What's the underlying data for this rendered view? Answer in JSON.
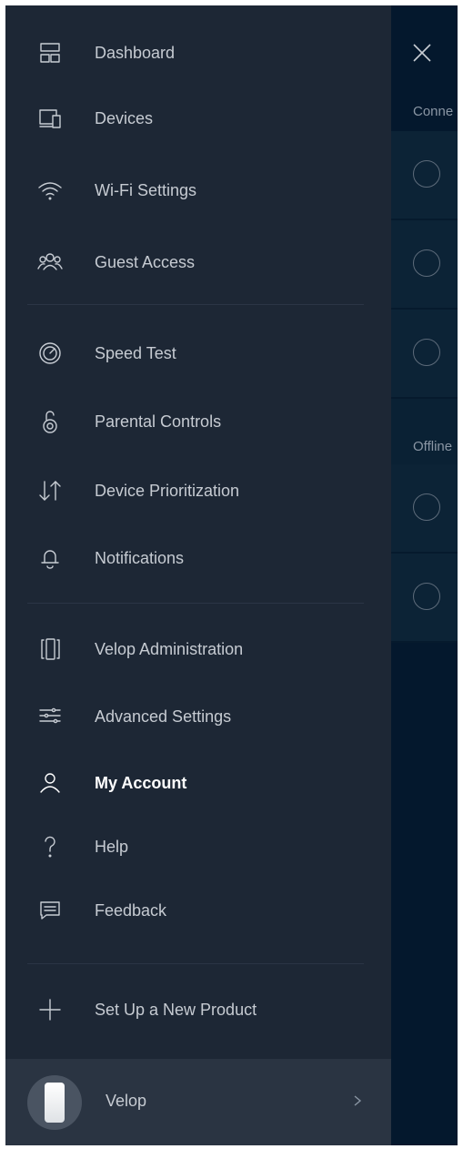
{
  "background": {
    "section_connected": "Conne",
    "section_offline": "Offline",
    "connected_rows": 3,
    "offline_rows": 2
  },
  "menu": {
    "items": [
      {
        "id": "dashboard",
        "label": "Dashboard",
        "icon": "dashboard-icon"
      },
      {
        "id": "devices",
        "label": "Devices",
        "icon": "devices-icon"
      },
      {
        "id": "wifi-settings",
        "label": "Wi-Fi Settings",
        "icon": "wifi-icon"
      },
      {
        "id": "guest-access",
        "label": "Guest Access",
        "icon": "guest-access-icon"
      },
      {
        "id": "speed-test",
        "label": "Speed Test",
        "icon": "speedometer-icon"
      },
      {
        "id": "parental-controls",
        "label": "Parental Controls",
        "icon": "lock-icon"
      },
      {
        "id": "device-prioritization",
        "label": "Device Prioritization",
        "icon": "arrows-updown-icon"
      },
      {
        "id": "notifications",
        "label": "Notifications",
        "icon": "bell-icon"
      },
      {
        "id": "velop-administration",
        "label": "Velop Administration",
        "icon": "node-admin-icon"
      },
      {
        "id": "advanced-settings",
        "label": "Advanced Settings",
        "icon": "sliders-icon"
      },
      {
        "id": "my-account",
        "label": "My Account",
        "icon": "user-icon",
        "active": true
      },
      {
        "id": "help",
        "label": "Help",
        "icon": "question-icon"
      },
      {
        "id": "feedback",
        "label": "Feedback",
        "icon": "feedback-icon"
      },
      {
        "id": "set-up-new-product",
        "label": "Set Up a New Product",
        "icon": "plus-icon"
      }
    ]
  },
  "product": {
    "label": "Velop"
  },
  "colors": {
    "drawer_bg": "#1d2735",
    "page_bg": "#03172a",
    "product_bar": "#2a3442",
    "text": "#c6cbd2",
    "active_text": "#ffffff"
  }
}
